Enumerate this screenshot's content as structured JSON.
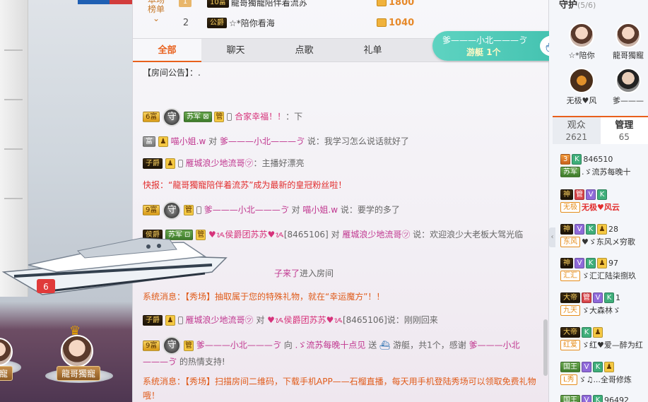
{
  "rank": {
    "label_line1": "本场",
    "label_line2": "榜单",
    "rows": [
      {
        "num": "1",
        "badge": "10富",
        "name": "龍哥獨寵陪伴着流苏",
        "score": "1800"
      },
      {
        "num": "2",
        "badge": "公爵",
        "name": "☆*陪你看海",
        "score": "1040"
      }
    ]
  },
  "tabs": [
    "全部",
    "聊天",
    "点歌",
    "礼单",
    "游"
  ],
  "chat": {
    "announcement": "【房间公告】：.",
    "messages": [
      {
        "badges": [
          "6富"
        ],
        "user": "合家幸福！！",
        "text": "：下"
      },
      {
        "user": "喵小姐.w",
        "mid": "对",
        "target": "爹———小北———ゔ",
        "text": "说：我学习怎么说话就好了"
      },
      {
        "user": "雁城浪少地流哥㋡",
        "text": "：主播好漂亮"
      },
      {
        "flash": "快报：“龍哥獨寵陪伴着流苏”成为最新的皇冠粉丝啦！"
      },
      {
        "user": "爹———小北———ゔ",
        "mid": "对",
        "target": "喵小姐.w",
        "text": "说：要学的多了"
      },
      {
        "user": "♥ᝰ侯爵团苏苏♥ᝰ",
        "uid": "[8465106]",
        "mid": "对",
        "target": "雁城浪少地流哥㋡",
        "text": "说：欢迎浪少大老板大驾光临"
      },
      {
        "enter_name": "子来了",
        "enter_text": "进入房间"
      },
      {
        "sys_prefix": "系统消息：【秀场】抽取属于您的特殊礼物，就在“幸运魔方”！！"
      },
      {
        "user": "雁城浪少地流哥㋡",
        "mid": "对",
        "target": "♥ᝰ侯爵团苏苏♥ᝰ",
        "uid": "[8465106]",
        "text": "说：刚刚回来"
      },
      {
        "user": "爹———小北———ゔ",
        "mid": "向",
        "target": ".ゞ流苏每晚十点见",
        "text": "送",
        "gift": "游艇，共1个，感谢",
        "thanks": "爹———小北———ゔ",
        "end": "的热情支持!"
      },
      {
        "sys2": "系统消息：【秀场】扫描房间二维码，下载手机APP——石榴直播，每天用手机登陆秀场可以领取免费礼物哦！"
      }
    ]
  },
  "yacht_notice": {
    "user": "爹———小北———ゔ",
    "gift_label": "游艇",
    "count": "1个"
  },
  "guard": {
    "title": "守护",
    "count": "(5/6)",
    "members": [
      "☆*陪你",
      "龍哥獨寵",
      "无极♥风",
      "爹———"
    ]
  },
  "side_tabs": [
    {
      "label": "观众",
      "count": "2621"
    },
    {
      "label": "管理",
      "count": "65"
    }
  ],
  "users": [
    {
      "badge": "3",
      "id": "846510"
    },
    {
      "badge": "苏军",
      "name": ".ゞ流苏每晚十"
    },
    {
      "badge": "无极",
      "name": "无极♥风云"
    },
    {
      "badge": "东风",
      "name": "♥ゞ东风メ穷歌",
      "level": "28"
    },
    {
      "badge": "汇汇",
      "name": "ゞ汇汇陆柒捌玖",
      "level": "97"
    },
    {
      "badge": "九天",
      "name": "ゞ大森林ゞ",
      "level": "1"
    },
    {
      "badge": "红爱",
      "name": "ゞ红♥爱—醉为红"
    },
    {
      "badge": "L秀",
      "name": "ゞ♫...全哥修炼"
    },
    {
      "badge": "国王",
      "id": "96492"
    }
  ],
  "left": {
    "fan_name": "龍哥獨寵",
    "fan_name_left": "寵"
  }
}
